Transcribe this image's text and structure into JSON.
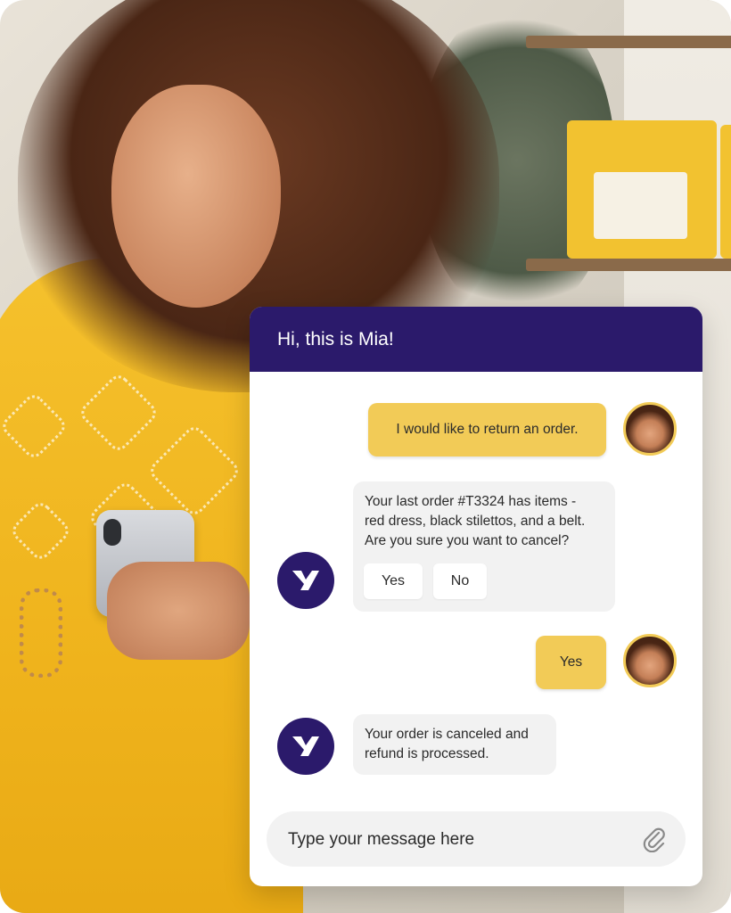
{
  "chat": {
    "header_title": "Hi, this is Mia!",
    "messages": [
      {
        "from": "user",
        "text": "I would like to return an order."
      },
      {
        "from": "bot",
        "text_lines": [
          "Your last order #T3324 has items -",
          "red dress, black stilettos, and a belt.",
          "Are you sure you want to cancel?"
        ],
        "options": [
          "Yes",
          "No"
        ]
      },
      {
        "from": "user",
        "text": "Yes"
      },
      {
        "from": "bot",
        "text_lines": [
          "Your order is canceled and",
          "refund is processed."
        ]
      }
    ],
    "composer": {
      "placeholder": "Type your message here"
    },
    "icons": {
      "user_avatar": "user-avatar-photo",
      "bot_avatar": "bot-logo-icon",
      "attach": "paperclip-icon"
    },
    "colors": {
      "header": "#2b1a6b",
      "user_bubble": "#f2cb57",
      "bot_bubble": "#f2f2f2",
      "bot_avatar": "#2b1a6b"
    }
  }
}
